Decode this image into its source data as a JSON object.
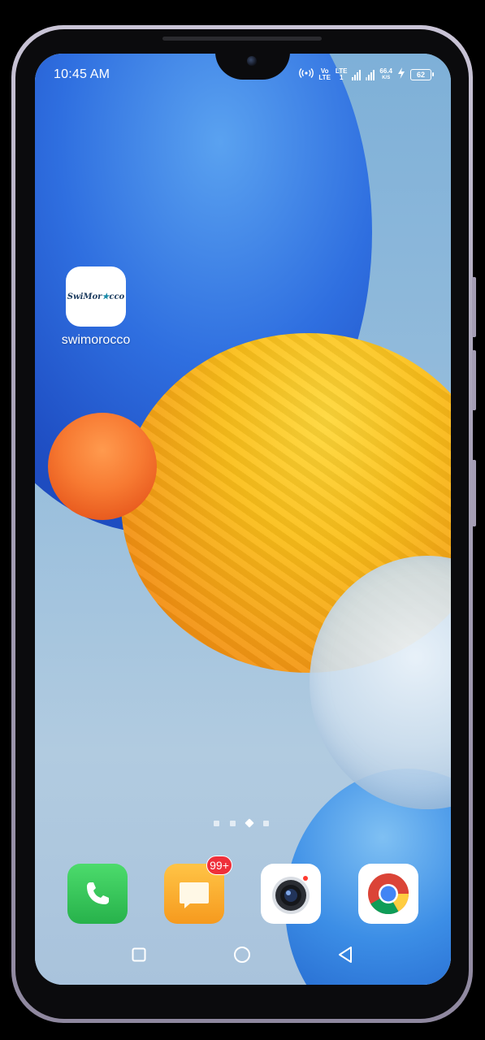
{
  "status_bar": {
    "time": "10:45 AM",
    "network_vo": "Vo",
    "network_lte_1": "LTE",
    "network_lte_2": "LTE",
    "network_sim": "1",
    "speed_value": "66.4",
    "speed_unit": "K/S",
    "battery": "62"
  },
  "home": {
    "apps": [
      {
        "label": "swimorocco",
        "icon": "swimorocco-logo",
        "logo_text": "SwiMor",
        "logo_star": "★",
        "logo_tail": "cco"
      }
    ],
    "page_indicator": {
      "pages": 4,
      "current": 3
    }
  },
  "dock": {
    "apps": [
      {
        "icon": "phone-icon",
        "color": "#34c759"
      },
      {
        "icon": "messages-icon",
        "color": "#f9a825",
        "badge": "99+"
      },
      {
        "icon": "camera-icon",
        "color": "#ffffff"
      },
      {
        "icon": "chrome-icon",
        "color": "#ffffff"
      }
    ]
  },
  "nav_bar": {
    "buttons": [
      "recents-icon",
      "home-icon",
      "back-icon"
    ]
  }
}
